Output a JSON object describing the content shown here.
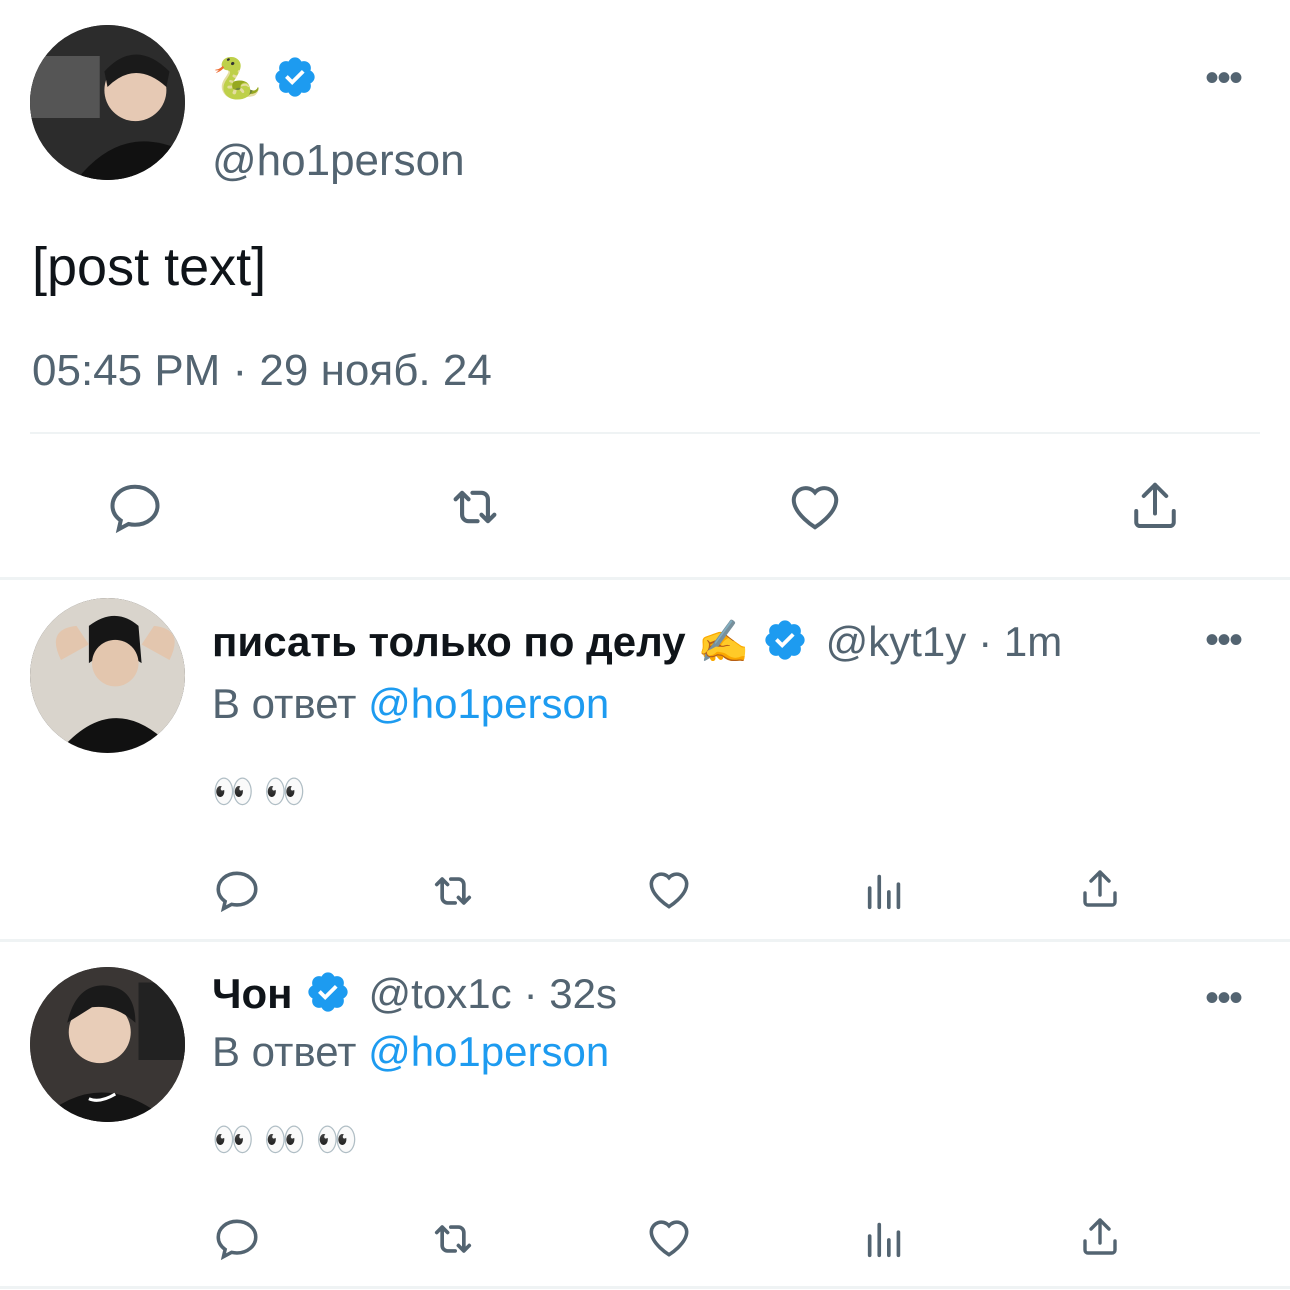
{
  "main_tweet": {
    "display_name": "🐍",
    "handle": "@ho1person",
    "text": "[post text]",
    "timestamp": "05:45 PM · 29 нояб. 24",
    "more_label": "•••"
  },
  "replies": [
    {
      "display_name": "писать только по делу ✍️",
      "handle": "@kyt1y",
      "time": "· 1m",
      "reply_prefix": "В ответ",
      "reply_to": "@ho1person",
      "text": "👀 👀",
      "more_label": "•••"
    },
    {
      "display_name": "Чон",
      "handle": "@tox1c",
      "time": "· 32s",
      "reply_prefix": "В ответ",
      "reply_to": "@ho1person",
      "text": "👀 👀 👀",
      "more_label": "•••"
    }
  ],
  "colors": {
    "accent": "#1d9bf0",
    "secondary_text": "#536471",
    "divider": "#eff3f4"
  },
  "icons": {
    "main_actions": [
      "reply-icon",
      "retweet-icon",
      "like-icon",
      "share-icon"
    ],
    "reply_actions": [
      "reply-icon",
      "retweet-icon",
      "like-icon",
      "views-icon",
      "share-icon"
    ]
  }
}
